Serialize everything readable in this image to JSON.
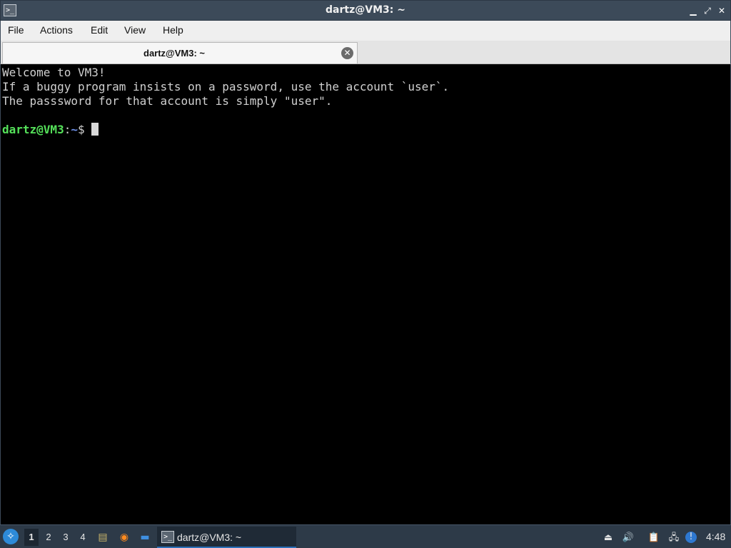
{
  "window": {
    "title": "dartz@VM3: ~",
    "app_icon": "terminal-icon",
    "app_icon_glyph": ">_",
    "controls": {
      "minimize_glyph": "▁",
      "maximize_glyph": "⤢",
      "close_glyph": "✕"
    }
  },
  "menubar": {
    "items": [
      "File",
      "Actions",
      "Edit",
      "View",
      "Help"
    ]
  },
  "tabs": [
    {
      "label": "dartz@VM3: ~",
      "close_glyph": "✕",
      "active": true
    }
  ],
  "terminal": {
    "lines": [
      "Welcome to VM3!",
      "If a buggy program insists on a password, use the account `user`.",
      "The passsword for that account is simply \"user\"."
    ],
    "prompt": {
      "user_host": "dartz@VM3",
      "separator": ":",
      "path": "~",
      "symbol": "$ "
    }
  },
  "taskbar": {
    "start_glyph": "✧",
    "workspaces": [
      "1",
      "2",
      "3",
      "4"
    ],
    "active_workspace": "1",
    "quick_launch": [
      {
        "icon": "file-manager-icon",
        "glyph": "▤"
      },
      {
        "icon": "firefox-icon",
        "glyph": "◉"
      },
      {
        "icon": "show-desktop-icon",
        "glyph": "▬"
      }
    ],
    "task": {
      "label": "dartz@VM3: ~",
      "icon_glyph": ">_"
    },
    "tray": [
      {
        "icon": "eject-icon",
        "glyph": "⏏"
      },
      {
        "icon": "volume-icon",
        "glyph": "🔊"
      },
      {
        "icon": "clipboard-icon",
        "glyph": "📋"
      },
      {
        "icon": "network-icon",
        "glyph": "🖧"
      },
      {
        "icon": "notification-icon",
        "glyph": "!"
      }
    ],
    "clock": "4:48"
  },
  "colors": {
    "titlebar": "#3c4a59",
    "terminal_bg": "#000000",
    "terminal_fg": "#d0d0d0",
    "prompt_user": "#55e15a",
    "prompt_path": "#6d8fe6",
    "taskbar": "#2d3a48"
  }
}
